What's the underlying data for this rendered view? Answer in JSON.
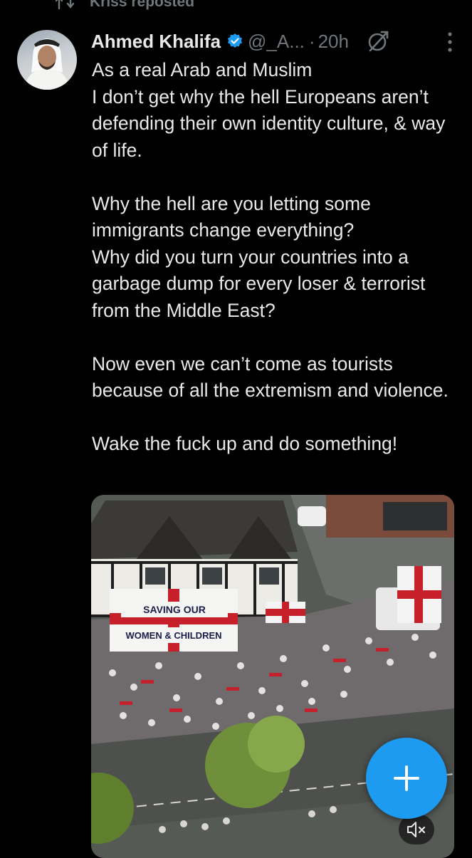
{
  "repost": {
    "icon": "repost-icon",
    "label": "Kriss reposted"
  },
  "author": {
    "display_name": "Ahmed Khalifa",
    "verified_icon": "verified-badge-icon",
    "handle": "@_A...",
    "separator": "·",
    "time": "20h"
  },
  "actions": {
    "grok_icon": "grok-icon",
    "more_icon": "more-options-icon"
  },
  "tweet": {
    "text": "As a real Arab and Muslim\nI don’t get why the hell Europeans aren’t defending their own identity culture, & way of life.\n\nWhy the hell are you letting some immigrants change everything?\nWhy did you turn your countries into a garbage dump for every loser & terrorist from the Middle East?\n\nNow even we can’t come as tourists because of all the extremism and violence.\n\nWake the fuck up and do something!"
  },
  "media": {
    "banner_line1": "SAVING OUR",
    "banner_line2": "WOMEN & CHILDREN",
    "mute_icon": "volume-muted-icon"
  },
  "compose": {
    "icon": "plus-icon"
  },
  "colors": {
    "background": "#000000",
    "text": "#e7e9ea",
    "secondary": "#71767b",
    "accent": "#1d9bf0"
  }
}
